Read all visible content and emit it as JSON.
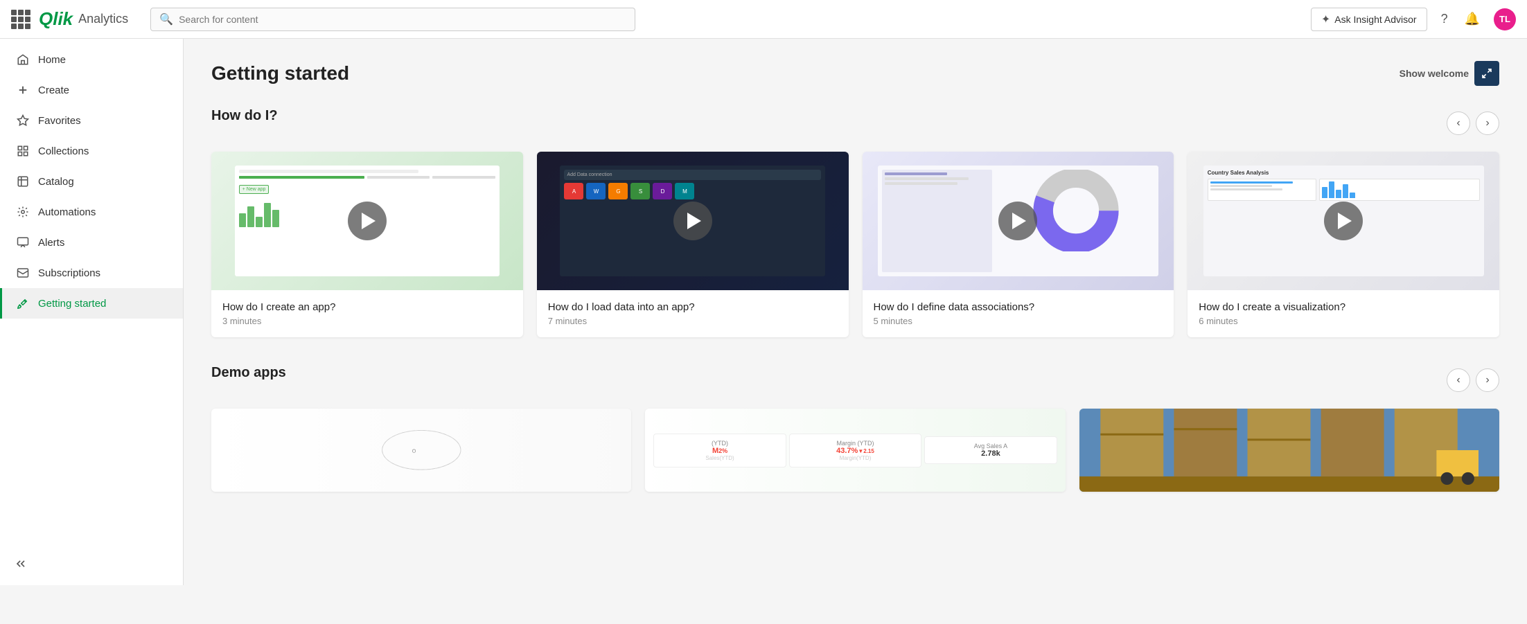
{
  "navbar": {
    "app_name": "Analytics",
    "search_placeholder": "Search for content",
    "insight_advisor_label": "Ask Insight Advisor",
    "avatar_initials": "TL"
  },
  "sidebar": {
    "items": [
      {
        "id": "home",
        "label": "Home",
        "icon": "home"
      },
      {
        "id": "create",
        "label": "Create",
        "icon": "plus"
      },
      {
        "id": "favorites",
        "label": "Favorites",
        "icon": "star"
      },
      {
        "id": "collections",
        "label": "Collections",
        "icon": "collections"
      },
      {
        "id": "catalog",
        "label": "Catalog",
        "icon": "catalog"
      },
      {
        "id": "automations",
        "label": "Automations",
        "icon": "automations"
      },
      {
        "id": "alerts",
        "label": "Alerts",
        "icon": "alerts"
      },
      {
        "id": "subscriptions",
        "label": "Subscriptions",
        "icon": "subscriptions"
      },
      {
        "id": "getting-started",
        "label": "Getting started",
        "icon": "rocket",
        "active": true
      }
    ],
    "collapse_label": "Collapse"
  },
  "main": {
    "page_title": "Getting started",
    "show_welcome_label": "Show welcome",
    "section_how_do_i": "How do I?",
    "section_demo_apps": "Demo apps",
    "videos": [
      {
        "title": "How do I create an app?",
        "duration": "3 minutes",
        "thumb_class": "thumb-1"
      },
      {
        "title": "How do I load data into an app?",
        "duration": "7 minutes",
        "thumb_class": "thumb-2"
      },
      {
        "title": "How do I define data associations?",
        "duration": "5 minutes",
        "thumb_class": "thumb-3"
      },
      {
        "title": "How do I create a visualization?",
        "duration": "6 minutes",
        "thumb_class": "thumb-4"
      }
    ],
    "demo_apps": [
      {
        "id": "demo-1",
        "type": "chart"
      },
      {
        "id": "demo-2",
        "type": "stats"
      },
      {
        "id": "demo-3",
        "type": "warehouse"
      }
    ]
  }
}
